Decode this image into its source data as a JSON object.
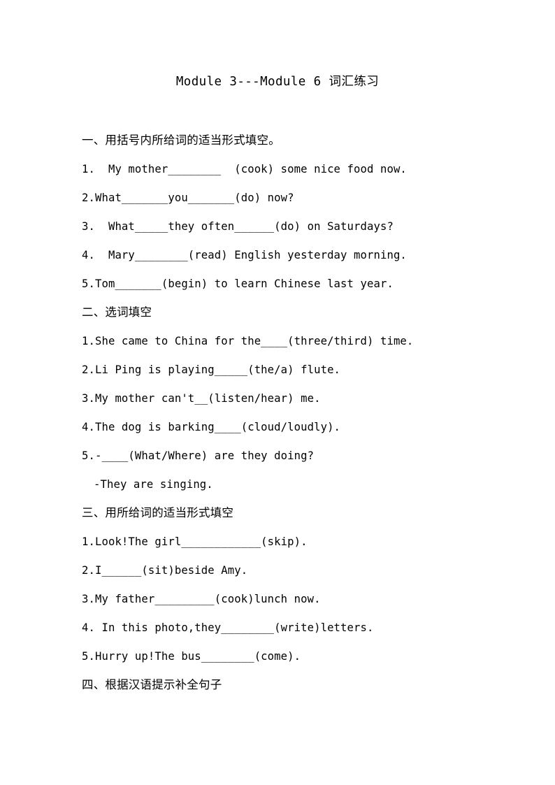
{
  "document": {
    "title": "Module 3---Module 6 词汇练习",
    "background_color": "#ffffff",
    "text_color": "#000000"
  },
  "sections": [
    {
      "heading": "一、用括号内所给词的适当形式填空。",
      "items": [
        "1.  My mother________  (cook) some nice food now.",
        "2.What_______you_______(do) now?",
        "3.  What_____they often______(do) on Saturdays?",
        "4.  Mary________(read) English yesterday morning.",
        "5.Tom_______(begin) to learn Chinese last year."
      ]
    },
    {
      "heading": "二、选词填空",
      "items": [
        "1.She came to China for the____(three/third) time.",
        "2.Li Ping is playing_____(the/a) flute.",
        "3.My mother can't__(listen/hear) me.",
        "4.The dog is barking____(cloud/loudly).",
        "5.-____(What/Where) are they doing?",
        "-They are singing."
      ]
    },
    {
      "heading": "三、用所给词的适当形式填空",
      "items": [
        "1.Look!The girl____________(skip).",
        "2.I______(sit)beside Amy.",
        "3.My father_________(cook)lunch now.",
        "4. In this photo,they________(write)letters.",
        "5.Hurry up!The bus________(come)."
      ]
    },
    {
      "heading": "四、根据汉语提示补全句子",
      "items": []
    }
  ]
}
